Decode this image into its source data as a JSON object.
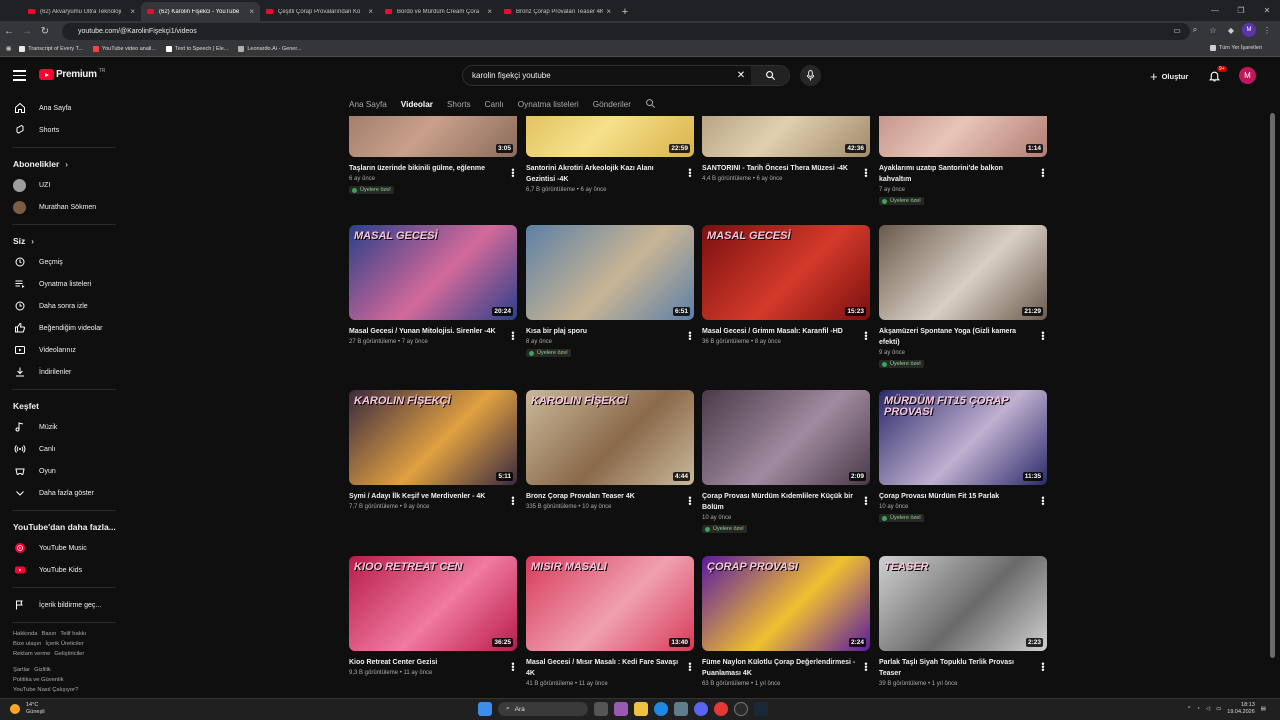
{
  "browser": {
    "tabs": [
      {
        "title": "(62) Akvaryumu Ultra Teknoloji",
        "active": false
      },
      {
        "title": "(62) Karolin Fişekci - YouTube",
        "active": true
      },
      {
        "title": "Çeşitli Çorap Provalarından Ko",
        "active": false
      },
      {
        "title": "Bordo ve Mürdüm Cream Çora",
        "active": false
      },
      {
        "title": "Bronz Çorap Provaları Teaser 4K",
        "active": false
      }
    ],
    "url": "youtube.com/@KarolinFişekçi1/videos",
    "bookmarks": [
      "Transcript of Every T...",
      "YouTube video anali...",
      "Text to Speech | Ele...",
      "Leonardo.Ai - Gener..."
    ],
    "all_bookmarks": "Tüm Yer İşaretleri",
    "profile_initial": "M"
  },
  "header": {
    "logo": "Premium",
    "logo_sup": "TR",
    "search_query": "karolin fişekçi youtube",
    "create_label": "Oluştur",
    "notif_count": "9+",
    "avatar_initial": "M"
  },
  "sidebar": {
    "main": [
      {
        "label": "Ana Sayfa",
        "icon": "home-icon"
      },
      {
        "label": "Shorts",
        "icon": "shorts-icon"
      }
    ],
    "subs_head": "Abonelikler",
    "subs": [
      {
        "label": "UZI",
        "color": "#9e9e9e"
      },
      {
        "label": "Murathan Sökmen",
        "color": "#7a5b44"
      }
    ],
    "you_head": "Siz",
    "you": [
      {
        "label": "Geçmiş",
        "icon": "history-icon"
      },
      {
        "label": "Oynatma listeleri",
        "icon": "playlists-icon"
      },
      {
        "label": "Daha sonra izle",
        "icon": "watch-later-icon"
      },
      {
        "label": "Beğendiğim videolar",
        "icon": "like-icon"
      },
      {
        "label": "Videolarınız",
        "icon": "your-videos-icon"
      },
      {
        "label": "İndirilenler",
        "icon": "download-icon"
      }
    ],
    "explore_head": "Keşfet",
    "explore": [
      {
        "label": "Müzik",
        "icon": "music-icon"
      },
      {
        "label": "Canlı",
        "icon": "live-icon"
      },
      {
        "label": "Oyun",
        "icon": "gaming-icon"
      },
      {
        "label": "Daha fazla göster",
        "icon": "chevron-down-icon"
      }
    ],
    "more_head": "YouTube'dan daha fazla...",
    "more": [
      {
        "label": "YouTube Music",
        "icon": "youtube-music-icon"
      },
      {
        "label": "YouTube Kids",
        "icon": "youtube-kids-icon"
      }
    ],
    "report": {
      "label": "İçerik bildirme geç...",
      "icon": "flag-icon"
    },
    "footer1": [
      "Hakkında",
      "Basın",
      "Telif hakkı"
    ],
    "footer2": [
      "Bize ulaşın",
      "İçerik Üreticiler"
    ],
    "footer3": [
      "Reklam verme",
      "Geliştiriciler"
    ],
    "footer4": [
      "Şartlar",
      "Gizlilik"
    ],
    "footer5": [
      "Politika ve Güvenlik"
    ],
    "footer6": [
      "YouTube Nasıl Çalışıyor?"
    ]
  },
  "channel_tabs": [
    {
      "label": "Ana Sayfa",
      "selected": false
    },
    {
      "label": "Videolar",
      "selected": true
    },
    {
      "label": "Shorts",
      "selected": false
    },
    {
      "label": "Canlı",
      "selected": false
    },
    {
      "label": "Oynatma listeleri",
      "selected": false
    },
    {
      "label": "Gönderiler",
      "selected": false
    }
  ],
  "members_label": "Üyelere özel",
  "videos": [
    {
      "title": "Taşların üzerinde bikinili gülme, eğlenme",
      "stats": "6 ay önce",
      "duration": "3:05",
      "members": true,
      "overlay": "",
      "colors": [
        "#8a6b5b",
        "#c9a08a"
      ]
    },
    {
      "title": "Santorini Akrotiri Arkeolojik Kazı Alanı Gezintisi -4K",
      "stats": "6,7 B görüntüleme • 6 ay önce",
      "duration": "22:59",
      "members": false,
      "overlay": "KAZI ALANI",
      "colors": [
        "#d8b24a",
        "#f5e08a"
      ]
    },
    {
      "title": "SANTORINI - Tarih Öncesi Thera Müzesi -4K",
      "stats": "4,4 B görüntüleme • 6 ay önce",
      "duration": "42:36",
      "members": false,
      "overlay": "",
      "colors": [
        "#a08a6a",
        "#e0d0b0"
      ]
    },
    {
      "title": "Ayaklarımı uzatıp Santorini'de balkon kahvaltım",
      "stats": "7 ay önce",
      "duration": "1:14",
      "members": true,
      "overlay": "",
      "colors": [
        "#b07c72",
        "#e8c4b8"
      ]
    },
    {
      "title": "Masal Gecesi / Yunan Mitolojisi. Sirenler -4K",
      "stats": "27 B görüntüleme • 7 ay önce",
      "duration": "20:24",
      "members": false,
      "overlay": "MASAL GECESİ",
      "colors": [
        "#2a3f8a",
        "#d46a9a"
      ]
    },
    {
      "title": "Kısa bir plaj sporu",
      "stats": "8 ay önce",
      "duration": "6:51",
      "members": true,
      "overlay": "",
      "colors": [
        "#5d7fa6",
        "#c8b595"
      ]
    },
    {
      "title": "Masal Gecesi / Grimm Masalı: Karanfil -HD",
      "stats": "36 B görüntüleme • 8 ay önce",
      "duration": "15:23",
      "members": false,
      "overlay": "MASAL GECESİ",
      "colors": [
        "#7a1010",
        "#d43a2a"
      ]
    },
    {
      "title": "Akşamüzeri Spontane Yoga (Gizli kamera efekti)",
      "stats": "9 ay önce",
      "duration": "21:29",
      "members": true,
      "overlay": "",
      "colors": [
        "#6a5a4e",
        "#d8cfc2"
      ]
    },
    {
      "title": "Symi / Adayı İlk Keşif ve Merdivenler - 4K",
      "stats": "7,7 B görüntüleme • 9 ay önce",
      "duration": "5:11",
      "members": false,
      "overlay": "KAROLIN FİŞEKÇİ",
      "colors": [
        "#3a2a40",
        "#e0a040"
      ]
    },
    {
      "title": "Bronz Çorap Provaları Teaser 4K",
      "stats": "335 B görüntüleme • 10 ay önce",
      "duration": "4:44",
      "members": false,
      "overlay": "KAROLIN FİŞEKCİ",
      "colors": [
        "#c9b89a",
        "#8a6a4a"
      ]
    },
    {
      "title": "Çorap Provası Mürdüm Kıdemlilere Küçük bir Bölüm",
      "stats": "10 ay önce",
      "duration": "2:09",
      "members": true,
      "overlay": "",
      "colors": [
        "#4a3a48",
        "#a08aa0"
      ]
    },
    {
      "title": "Çorap Provası Mürdüm Fit 15 Parlak",
      "stats": "10 ay önce",
      "duration": "11:35",
      "members": true,
      "overlay": "MÜRDÜM FIT15 ÇORAP PROVASI",
      "colors": [
        "#2a2a6a",
        "#c0b0d0"
      ]
    },
    {
      "title": "Kioo Retreat Center Gezisi",
      "stats": "9,3 B görüntüleme • 11 ay önce",
      "duration": "36:25",
      "members": false,
      "overlay": "KIOO RETREAT CEN",
      "colors": [
        "#b81c4a",
        "#f07aa0"
      ]
    },
    {
      "title": "Masal Gecesi / Mısır Masalı : Kedi Fare Savaşı 4K",
      "stats": "41 B görüntüleme • 11 ay önce",
      "duration": "13:40",
      "members": false,
      "overlay": "MISIR MASALI",
      "colors": [
        "#d83a5a",
        "#f0a0b0"
      ]
    },
    {
      "title": "Füme Naylon Külotlu Çorap Değerlendirmesi - Puanlaması 4K",
      "stats": "63 B görüntüleme • 1 yıl önce",
      "duration": "2:24",
      "members": false,
      "overlay": "ÇORAP PROVASI",
      "colors": [
        "#5a1aa0",
        "#f0c030"
      ]
    },
    {
      "title": "Parlak Taşlı Siyah Topuklu Terlik Provası Teaser",
      "stats": "39 B görüntüleme • 1 yıl önce",
      "duration": "2:23",
      "members": false,
      "overlay": "TEASER",
      "colors": [
        "#d0d0d0",
        "#6a6a6a"
      ]
    }
  ],
  "taskbar": {
    "weather_temp": "14°C",
    "weather_desc": "Güneşli",
    "search_label": "Ara",
    "time": "18:13",
    "date": "19.04.2026"
  }
}
